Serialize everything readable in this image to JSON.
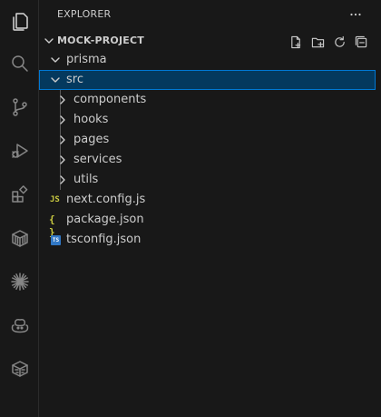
{
  "activity_bar": {
    "items": [
      {
        "icon": "files-icon",
        "active": true
      },
      {
        "icon": "search-icon",
        "active": false
      },
      {
        "icon": "source-control-icon",
        "active": false
      },
      {
        "icon": "run-debug-icon",
        "active": false
      },
      {
        "icon": "extensions-icon",
        "active": false
      },
      {
        "icon": "containers-icon",
        "active": false
      },
      {
        "icon": "sparkle-icon",
        "active": false
      },
      {
        "icon": "copilot-icon",
        "active": false
      },
      {
        "icon": "docker-icon",
        "active": false
      }
    ]
  },
  "sidebar": {
    "title": "EXPLORER",
    "more_icon": "ellipsis-icon",
    "project": {
      "name": "MOCK-PROJECT",
      "actions": [
        "new-file-icon",
        "new-folder-icon",
        "refresh-icon",
        "collapse-all-icon"
      ]
    },
    "tree": [
      {
        "label": "prisma",
        "type": "folder",
        "expanded": true,
        "depth": 0
      },
      {
        "label": "src",
        "type": "folder",
        "expanded": true,
        "depth": 0,
        "selected": true
      },
      {
        "label": "components",
        "type": "folder",
        "expanded": false,
        "depth": 1
      },
      {
        "label": "hooks",
        "type": "folder",
        "expanded": false,
        "depth": 1
      },
      {
        "label": "pages",
        "type": "folder",
        "expanded": false,
        "depth": 1
      },
      {
        "label": "services",
        "type": "folder",
        "expanded": false,
        "depth": 1
      },
      {
        "label": "utils",
        "type": "folder",
        "expanded": false,
        "depth": 1
      },
      {
        "label": "next.config.js",
        "type": "file",
        "badge": "JS",
        "depth": 0
      },
      {
        "label": "package.json",
        "type": "file",
        "badge": "{ }",
        "depth": 0
      },
      {
        "label": "tsconfig.json",
        "type": "file",
        "badge": "TS",
        "depth": 0
      }
    ]
  },
  "colors": {
    "background": "#181818",
    "selection": "#04395e",
    "focus_border": "#0078d4",
    "js_yellow": "#cbcb41",
    "ts_blue": "#3178c6"
  }
}
